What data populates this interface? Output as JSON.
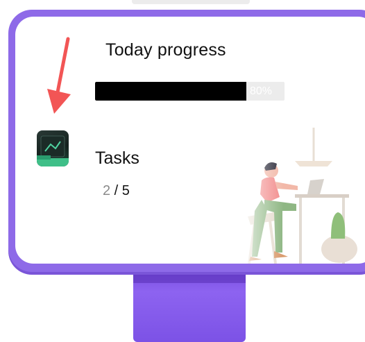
{
  "screen": {
    "title": "Today progress",
    "progress": {
      "value": 80,
      "label": "80%"
    },
    "tasks": {
      "heading": "Tasks",
      "done": "2",
      "separator": " / ",
      "total": "5"
    }
  },
  "icons": {
    "app": "app-icon",
    "annotation": "arrow-pointer-icon",
    "illustration": "person-working-at-desk-illustration"
  },
  "colors": {
    "bezel": "#8e6ae8",
    "stand": "#7c52e6",
    "progress_fill": "#000000",
    "progress_track": "#ececec",
    "arrow": "#f25555",
    "tasks_done": "#8a8a8a"
  }
}
